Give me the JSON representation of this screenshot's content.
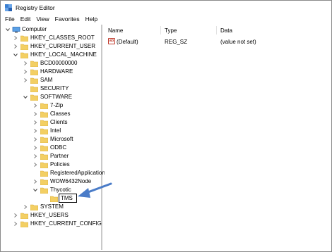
{
  "window": {
    "title": "Registry Editor"
  },
  "menu": [
    "File",
    "Edit",
    "View",
    "Favorites",
    "Help"
  ],
  "tree": {
    "root": "Computer",
    "hkcr": "HKEY_CLASSES_ROOT",
    "hkcu": "HKEY_CURRENT_USER",
    "hklm": "HKEY_LOCAL_MACHINE",
    "bcd": "BCD00000000",
    "hardware": "HARDWARE",
    "sam": "SAM",
    "security": "SECURITY",
    "software": "SOFTWARE",
    "sevenzip": "7-Zip",
    "classes": "Classes",
    "clients": "Clients",
    "intel": "Intel",
    "microsoft": "Microsoft",
    "odbc": "ODBC",
    "partner": "Partner",
    "policies": "Policies",
    "registered": "RegisteredApplication",
    "wow": "WOW6432Node",
    "thycotic": "Thycotic",
    "new_key": "TMS",
    "system": "SYSTEM",
    "hku": "HKEY_USERS",
    "hkcc": "HKEY_CURRENT_CONFIG"
  },
  "list": {
    "columns": {
      "name": "Name",
      "type": "Type",
      "data": "Data"
    },
    "rows": [
      {
        "icon": "ab",
        "name": "(Default)",
        "type": "REG_SZ",
        "data": "(value not set)"
      }
    ]
  },
  "colors": {
    "folder": "#f3cf63",
    "folder_dark": "#d8a93a",
    "arrow": "#4a7cc8",
    "accent": "#3b7fd1"
  }
}
